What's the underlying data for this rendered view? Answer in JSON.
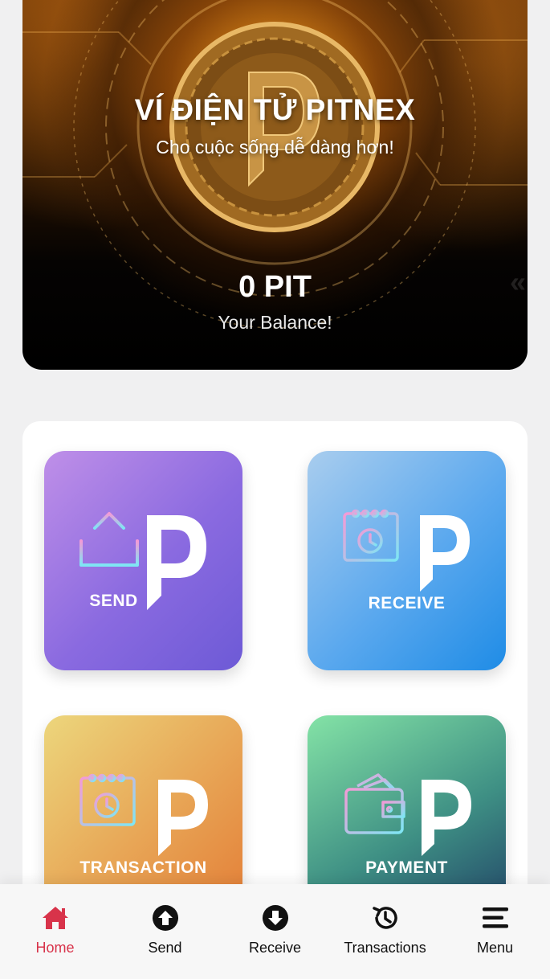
{
  "hero": {
    "title": "VÍ ĐIỆN TỬ PITNEX",
    "subtitle": "Cho cuộc sống dễ dàng hơn!",
    "balance": "0 PIT",
    "balance_label": "Your Balance!",
    "background_icon": "pitnex-coin"
  },
  "actions": [
    {
      "label": "SEND",
      "icon": "upload-icon"
    },
    {
      "label": "RECEIVE",
      "icon": "calendar-clock-icon"
    },
    {
      "label": "TRANSACTION",
      "icon": "calendar-clock-icon"
    },
    {
      "label": "PAYMENT",
      "icon": "wallet-icon"
    }
  ],
  "bottom_nav": [
    {
      "label": "Home",
      "icon": "home-icon",
      "active": true
    },
    {
      "label": "Send",
      "icon": "arrow-up-circle-icon"
    },
    {
      "label": "Receive",
      "icon": "arrow-down-circle-icon"
    },
    {
      "label": "Transactions",
      "icon": "history-icon"
    },
    {
      "label": "Menu",
      "icon": "menu-icon"
    }
  ],
  "colors": {
    "active_nav": "#d8334a",
    "send_tile": "#8a6ae0",
    "receive_tile": "#3a9cec",
    "transaction_tile": "#e79e50",
    "payment_tile": "#3e8f84"
  }
}
